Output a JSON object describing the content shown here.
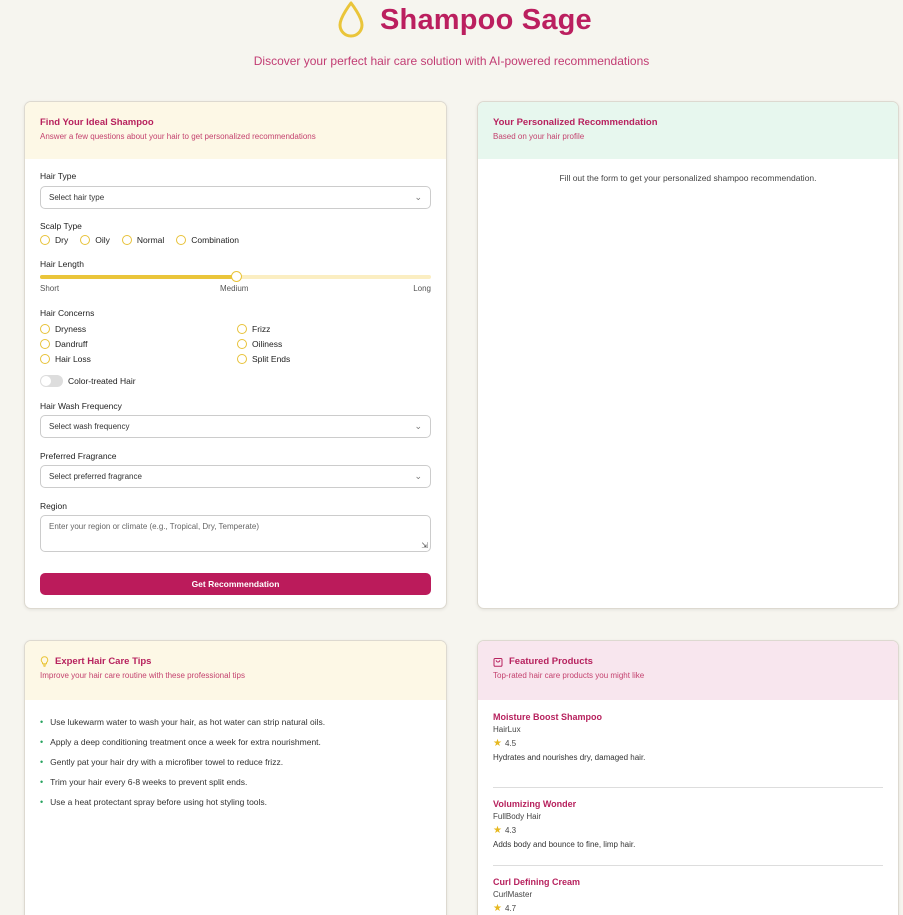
{
  "brand": {
    "title": "Shampoo Sage",
    "tagline": "Discover your perfect hair care solution with AI-powered recommendations"
  },
  "form": {
    "title": "Find Your Ideal Shampoo",
    "subtitle": "Answer a few questions about your hair to get personalized recommendations",
    "hair_type": {
      "label": "Hair Type",
      "value": "Select hair type"
    },
    "scalp_type": {
      "label": "Scalp Type",
      "options": [
        "Dry",
        "Oily",
        "Normal",
        "Combination"
      ]
    },
    "hair_length": {
      "label": "Hair Length",
      "min_label": "Short",
      "mid_label": "Medium",
      "max_label": "Long",
      "value_fraction": 0.5
    },
    "concerns": {
      "label": "Hair Concerns",
      "options": [
        "Dryness",
        "Frizz",
        "Dandruff",
        "Oiliness",
        "Hair Loss",
        "Split Ends"
      ]
    },
    "color_treated": {
      "label": "Color-treated Hair"
    },
    "wash_frequency": {
      "label": "Hair Wash Frequency",
      "value": "Select wash frequency"
    },
    "fragrance": {
      "label": "Preferred Fragrance",
      "value": "Select preferred fragrance"
    },
    "region": {
      "label": "Region",
      "placeholder": "Enter your region or climate (e.g., Tropical, Dry, Temperate)"
    },
    "submit": "Get Recommendation"
  },
  "recommendation": {
    "title": "Your Personalized Recommendation",
    "subtitle": "Based on your hair profile",
    "empty": "Fill out the form to get your personalized shampoo recommendation."
  },
  "tips": {
    "title": "Expert Hair Care Tips",
    "subtitle": "Improve your hair care routine with these professional tips",
    "items": [
      "Use lukewarm water to wash your hair, as hot water can strip natural oils.",
      "Apply a deep conditioning treatment once a week for extra nourishment.",
      "Gently pat your hair dry with a microfiber towel to reduce frizz.",
      "Trim your hair every 6-8 weeks to prevent split ends.",
      "Use a heat protectant spray before using hot styling tools."
    ]
  },
  "products": {
    "title": "Featured Products",
    "subtitle": "Top-rated hair care products you might like",
    "items": [
      {
        "name": "Moisture Boost Shampoo",
        "brand": "HairLux",
        "rating": "4.5",
        "desc": "Hydrates and nourishes dry, damaged hair."
      },
      {
        "name": "Volumizing Wonder",
        "brand": "FullBody Hair",
        "rating": "4.3",
        "desc": "Adds body and bounce to fine, limp hair."
      },
      {
        "name": "Curl Defining Cream",
        "brand": "CurlMaster",
        "rating": "4.7",
        "desc": ""
      }
    ]
  },
  "colors": {
    "accent": "#bb1f5f",
    "gold": "#eac53a",
    "success": "#27a35f"
  }
}
